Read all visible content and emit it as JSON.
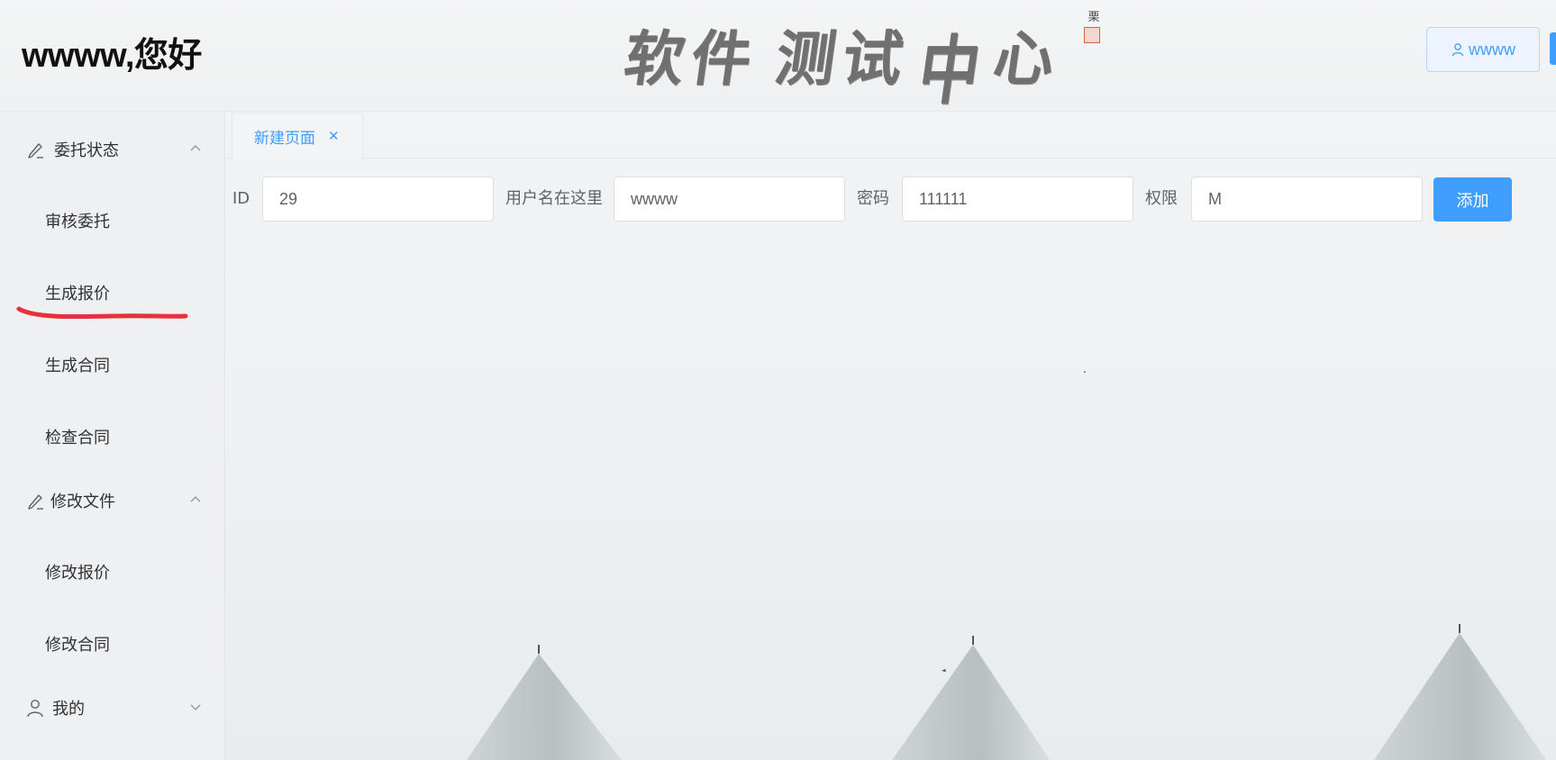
{
  "header": {
    "greeting": "wwww,您好",
    "title_chars": [
      "软",
      "件",
      "测",
      "试",
      "中",
      "心"
    ],
    "signature": "栗",
    "user_button_label": "wwww"
  },
  "sidebar": {
    "groups": [
      {
        "label": "委托状态",
        "icon": "edit-icon",
        "expanded": true,
        "items": [
          "审核委托",
          "生成报价",
          "生成合同",
          "检查合同"
        ]
      },
      {
        "label": "修改文件",
        "icon": "edit-icon",
        "expanded": true,
        "items": [
          "修改报价",
          "修改合同"
        ]
      },
      {
        "label": "我的",
        "icon": "user-icon",
        "expanded": false,
        "items": []
      }
    ]
  },
  "tabs": [
    {
      "label": "新建页面",
      "active": true
    }
  ],
  "form": {
    "id_label": "ID",
    "id_value": "29",
    "username_label": "用户名在这里",
    "username_value": "wwww",
    "password_label": "密码",
    "password_value": "111111",
    "permission_label": "权限",
    "permission_value": "M",
    "add_button": "添加"
  },
  "colors": {
    "primary": "#409eff",
    "primary_light": "#ecf5ff",
    "annotation_red": "#e8313a",
    "sidebar_bg": "#eef0f1"
  }
}
